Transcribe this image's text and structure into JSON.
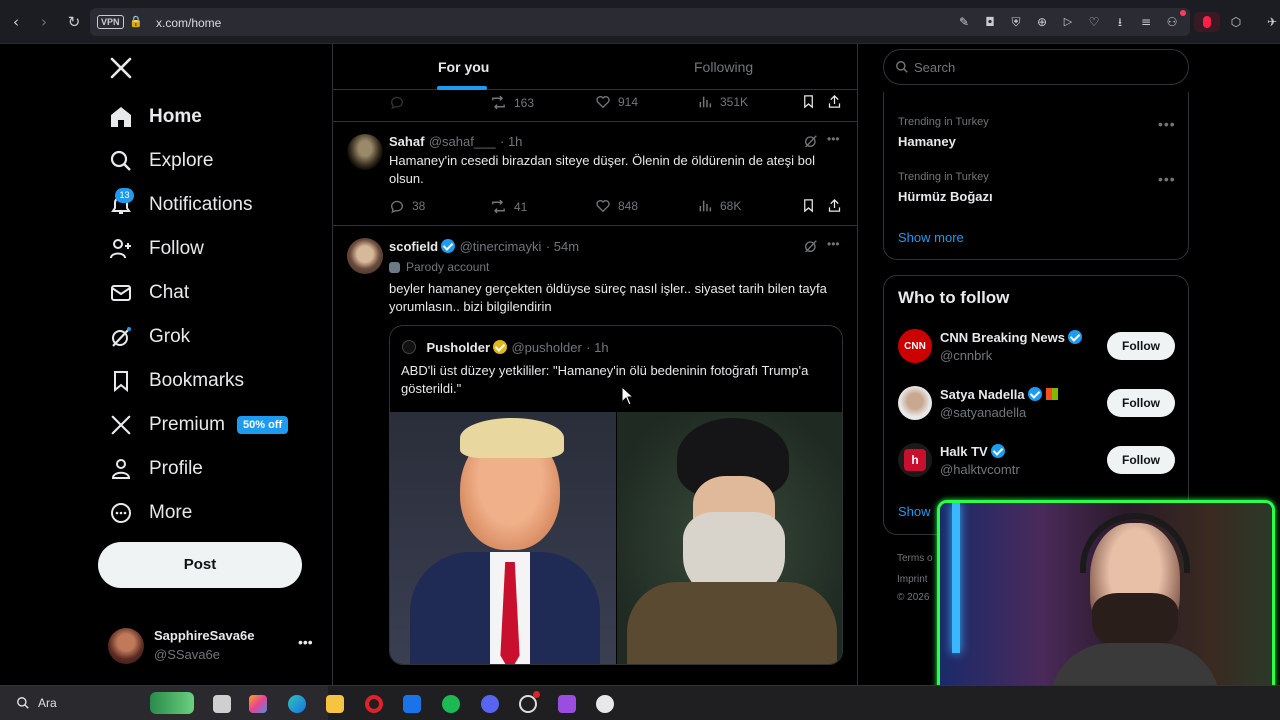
{
  "browser": {
    "url": "x.com/home",
    "vpn_label": "VPN"
  },
  "sidebar": {
    "items": [
      {
        "label": "Home",
        "icon": "home-icon"
      },
      {
        "label": "Explore",
        "icon": "search-icon"
      },
      {
        "label": "Notifications",
        "icon": "bell-icon"
      },
      {
        "label": "Follow",
        "icon": "follow-icon"
      },
      {
        "label": "Chat",
        "icon": "mail-icon"
      },
      {
        "label": "Grok",
        "icon": "grok-icon"
      },
      {
        "label": "Bookmarks",
        "icon": "bookmark-icon"
      },
      {
        "label": "Premium",
        "icon": "x-logo-icon"
      },
      {
        "label": "Profile",
        "icon": "person-icon"
      },
      {
        "label": "More",
        "icon": "more-circle-icon"
      }
    ],
    "notifications_count": "13",
    "premium_badge": "50% off",
    "post_label": "Post",
    "account": {
      "name": "SapphireSava6e",
      "handle": "@SSava6e"
    }
  },
  "feed": {
    "tabs": [
      "For you",
      "Following"
    ],
    "active_tab": "For you",
    "top_actions": {
      "retweets": "163",
      "likes": "914",
      "views": "351K"
    },
    "tweets": [
      {
        "name": "Sahaf",
        "handle": "@sahaf___",
        "time": "· 1h",
        "text": "Hamaney'in cesedi birazdan siteye düşer. Ölenin de öldürenin de ateşi bol olsun.",
        "replies": "38",
        "retweets": "41",
        "likes": "848",
        "views": "68K"
      },
      {
        "name": "scofield",
        "handle": "@tinercimayki",
        "time": "· 54m",
        "label": "Parody account",
        "text": "beyler hamaney gerçekten öldüyse süreç nasıl işler.. siyaset tarih bilen tayfa yorumlasın.. bizi bilgilendirin",
        "quote": {
          "name": "Pusholder",
          "handle": "@pusholder",
          "time": "· 1h",
          "text": "ABD'li üst düzey yetkililer: \"Hamaney'in ölü bedeninin fotoğrafı Trump'a gösterildi.\""
        }
      }
    ]
  },
  "right": {
    "search_placeholder": "Search",
    "trends": [
      {
        "meta": "Trending in Turkey",
        "name": "Hamaney"
      },
      {
        "meta": "Trending in Turkey",
        "name": "Hürmüz Boğazı"
      }
    ],
    "show_more": "Show more",
    "who_to_follow": {
      "title": "Who to follow",
      "accounts": [
        {
          "name": "CNN Breaking News",
          "handle": "@cnnbrk"
        },
        {
          "name": "Satya Nadella",
          "handle": "@satyanadella"
        },
        {
          "name": "Halk TV",
          "handle": "@halktvcomtr"
        }
      ],
      "follow_label": "Follow",
      "show_more_partial": "Show"
    },
    "footer": [
      "Terms o",
      "Imprint",
      "© 2026"
    ]
  },
  "taskbar": {
    "search_label": "Ara"
  },
  "colors": {
    "accent": "#1d9bf0",
    "background": "#000000",
    "webcam_frame": "#2bff4a"
  }
}
